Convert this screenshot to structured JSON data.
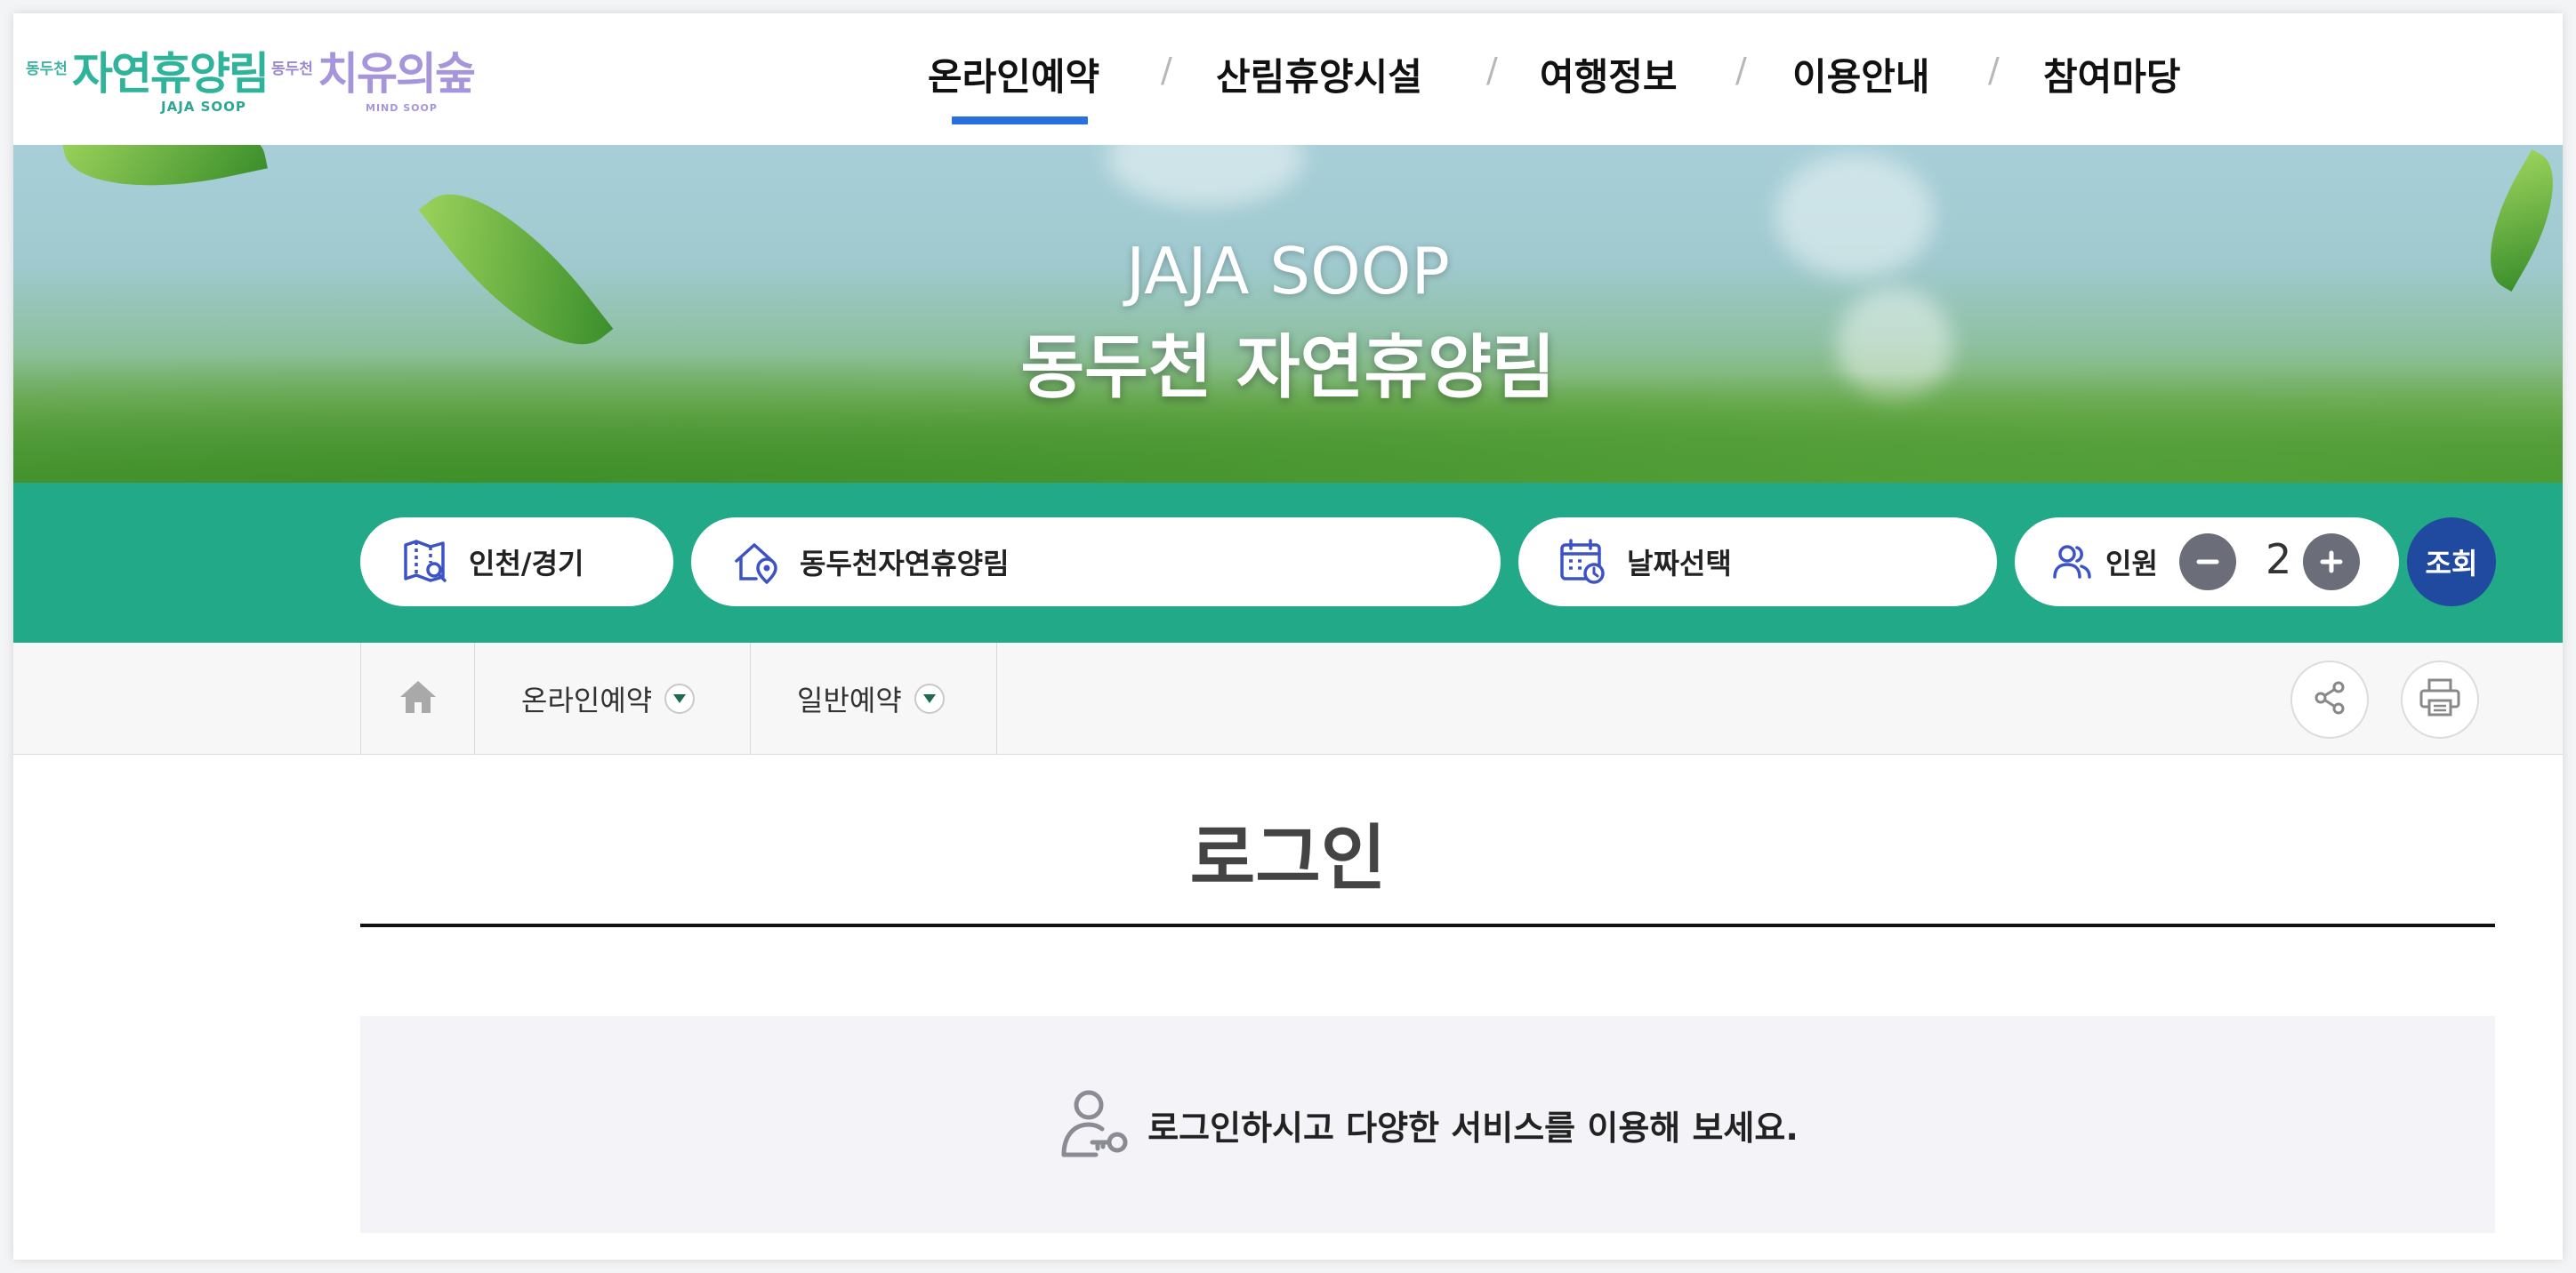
{
  "header": {
    "logo_jaja": {
      "small": "동두천",
      "main": "자연휴양림",
      "sub": "JAJA SOOP"
    },
    "logo_mind": {
      "small": "동두천",
      "main": "치유의숲",
      "sub": "MIND SOOP"
    },
    "nav": [
      "온라인예약",
      "산림휴양시설",
      "여행정보",
      "이용안내",
      "참여마당"
    ],
    "nav_separator": "/",
    "active_nav": "온라인예약",
    "accent_color": "#2a6fe0"
  },
  "hero": {
    "title_en": "JAJA SOOP",
    "title_ko": "동두천 자연휴양림"
  },
  "search": {
    "region": "인천/경기",
    "forest": "동두천자연휴양림",
    "date": "날짜선택",
    "people_label": "인원",
    "people_count": "2",
    "submit": "조회",
    "bar_color": "#22a987",
    "submit_color": "#1f4aa0"
  },
  "location": {
    "home_icon": "home-icon",
    "menu1": "온라인예약",
    "menu2": "일반예약",
    "share_icon": "share-icon",
    "print_icon": "print-icon"
  },
  "content": {
    "title": "로그인",
    "notice": "로그인하시고 다양한 서비스를 이용해 보세요.",
    "notice_icon": "user-key-icon"
  }
}
